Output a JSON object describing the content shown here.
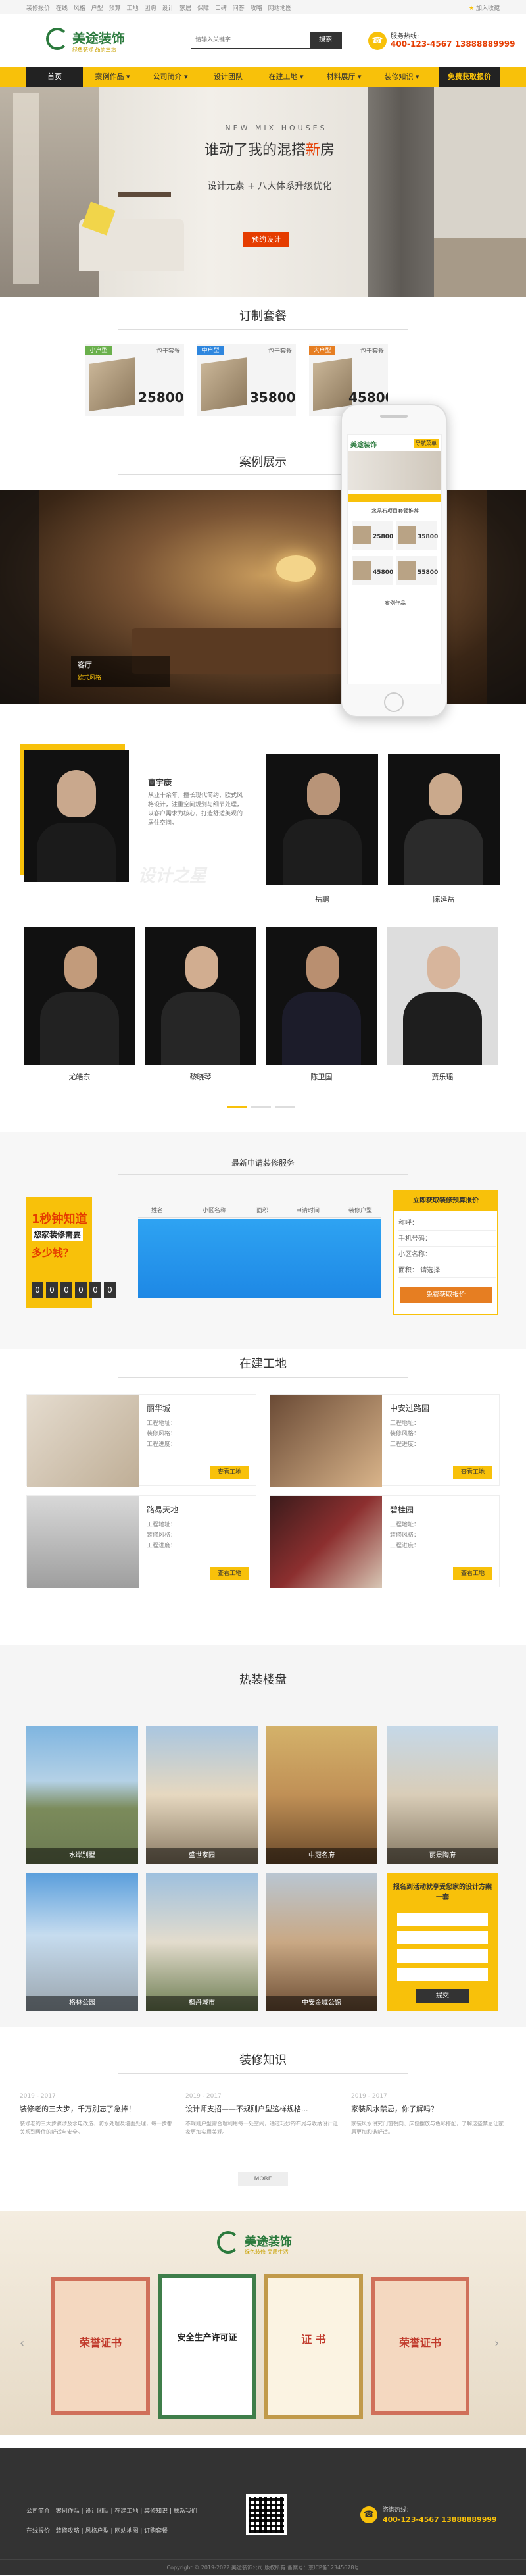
{
  "topbar": {
    "links": [
      "装修报价",
      "在线",
      "风格",
      "户型",
      "预算",
      "工地",
      "团购",
      "设计",
      "家居",
      "保障",
      "口碑",
      "问答",
      "攻略",
      "网站地图"
    ],
    "favorite": "加入收藏"
  },
  "header": {
    "brand": "美途装饰",
    "slogan": "绿色装修 品质生活",
    "search_placeholder": "请输入关键字",
    "search_button": "搜索",
    "hotline_label": "服务热线:",
    "hotline_number": "400-123-4567  13888889999"
  },
  "nav": {
    "items": [
      "首页",
      "案例作品",
      "公司简介",
      "设计团队",
      "在建工地",
      "材料展厅",
      "装修知识",
      "免费获取报价"
    ]
  },
  "banner": {
    "en_title": "NEW MIX HOUSES",
    "title_prefix": "谁动了我的混搭",
    "title_highlight": "新",
    "title_suffix": "房",
    "subtitle": "设计元素 + 八大体系升级优化",
    "cta": "预约设计"
  },
  "packages": {
    "title": "订制套餐",
    "items": [
      {
        "tag": "小户型",
        "tag2": "包干套餐",
        "price": "25800",
        "tag_color": "#6ab04c"
      },
      {
        "tag": "中户型",
        "tag2": "包干套餐",
        "price": "35800",
        "tag_color": "#2e86de"
      },
      {
        "tag": "大户型",
        "tag2": "包干套餐",
        "price": "45800",
        "tag_color": "#e67e22"
      }
    ]
  },
  "phone": {
    "brand": "美途装饰",
    "menu": "导航菜单",
    "section": "水晶石项目套餐推荐",
    "prices": [
      "25800",
      "35800",
      "45800",
      "55800"
    ],
    "footer_label": "案例作品"
  },
  "cases": {
    "title": "案例展示",
    "caption": "客厅",
    "caption_sub": "欧式风格"
  },
  "designers": {
    "featured_name": "曹宇康",
    "featured_desc": "从业十余年，擅长现代简约、欧式风格设计，注重空间规划与细节处理，以客户需求为核心，打造舒适美观的居住空间。",
    "watermark": "设计之星",
    "row1_names": [
      "岳鹏",
      "陈延岳"
    ],
    "row2_names": [
      "尤皓东",
      "黎晓琴",
      "陈卫国",
      "贾乐瑶"
    ]
  },
  "apply": {
    "title": "最新申请装修服务",
    "columns": [
      "姓名",
      "小区名称",
      "面积",
      "申请时间",
      "装修户型"
    ],
    "promo_line1": "1秒钟知道",
    "promo_line2": "您家装修需要",
    "promo_line3": "多少钱？",
    "counter": [
      "0",
      "0",
      "0",
      "0",
      "0",
      "0"
    ],
    "form_title": "立即获取装修预算报价",
    "form_fields": [
      "称呼：",
      "手机号码：",
      "小区名称：",
      "面积："
    ],
    "form_select": "请选择",
    "form_submit": "免费获取报价"
  },
  "sites": {
    "title": "在建工地",
    "items": [
      {
        "name": "丽华城",
        "l1": "工程地址：",
        "l2": "装修风格：",
        "l3": "工程进度：",
        "btn": "查看工地"
      },
      {
        "name": "中安过路园",
        "l1": "工程地址：",
        "l2": "装修风格：",
        "l3": "工程进度：",
        "btn": "查看工地"
      },
      {
        "name": "路易天地",
        "l1": "工程地址：",
        "l2": "装修风格：",
        "l3": "工程进度：",
        "btn": "查看工地"
      },
      {
        "name": "碧桂园",
        "l1": "工程地址：",
        "l2": "装修风格：",
        "l3": "工程进度：",
        "btn": "查看工地"
      }
    ]
  },
  "estates": {
    "title": "热装楼盘",
    "row1": [
      "水岸别墅",
      "盛世家园",
      "中冠名府",
      "丽景陶府"
    ],
    "row2": [
      "格林公园",
      "枫丹城市",
      "中安金域公馆"
    ],
    "form_title": "报名到活动就享受您家的设计方案一套",
    "form_submit": "提交"
  },
  "knowledge": {
    "title": "装修知识",
    "items": [
      {
        "date": "2019 - 2017",
        "title": "装修老的三大步，千万别忘了急捧！",
        "text": "装修老的三大步骤涉及水电改造、防水处理及墙面处理，每一步都关系到居住的舒适与安全。"
      },
      {
        "date": "2019 - 2017",
        "title": "设计师支招——不规则户型这样规格...",
        "text": "不规则户型需合理利用每一处空间，通过巧妙的布局与收纳设计让家更加实用美观。"
      },
      {
        "date": "2019 - 2017",
        "title": "家装风水禁忌，你了解吗？",
        "text": "家装风水讲究门窗朝向、床位摆放与色彩搭配，了解这些禁忌让家居更加和谐舒适。"
      }
    ],
    "more": "MORE"
  },
  "honors": {
    "brand": "美途装饰",
    "slogan": "绿色装修 品质生活",
    "items": [
      "荣誉证书",
      "安全生产许可证",
      "证 书",
      "荣誉证书"
    ]
  },
  "footer": {
    "links": [
      "公司简介",
      "案例作品",
      "设计团队",
      "在建工地",
      "装修知识",
      "联系我们"
    ],
    "links2": [
      "在线报价",
      "装修攻略",
      "风格户型",
      "网站地图",
      "订购套餐"
    ],
    "hotline_label": "咨询热线：",
    "hotline": "400-123-4567  13888889999",
    "copyright": "Copyright © 2019-2022 美途装饰公司 版权所有 备案号：京ICP备12345678号"
  }
}
